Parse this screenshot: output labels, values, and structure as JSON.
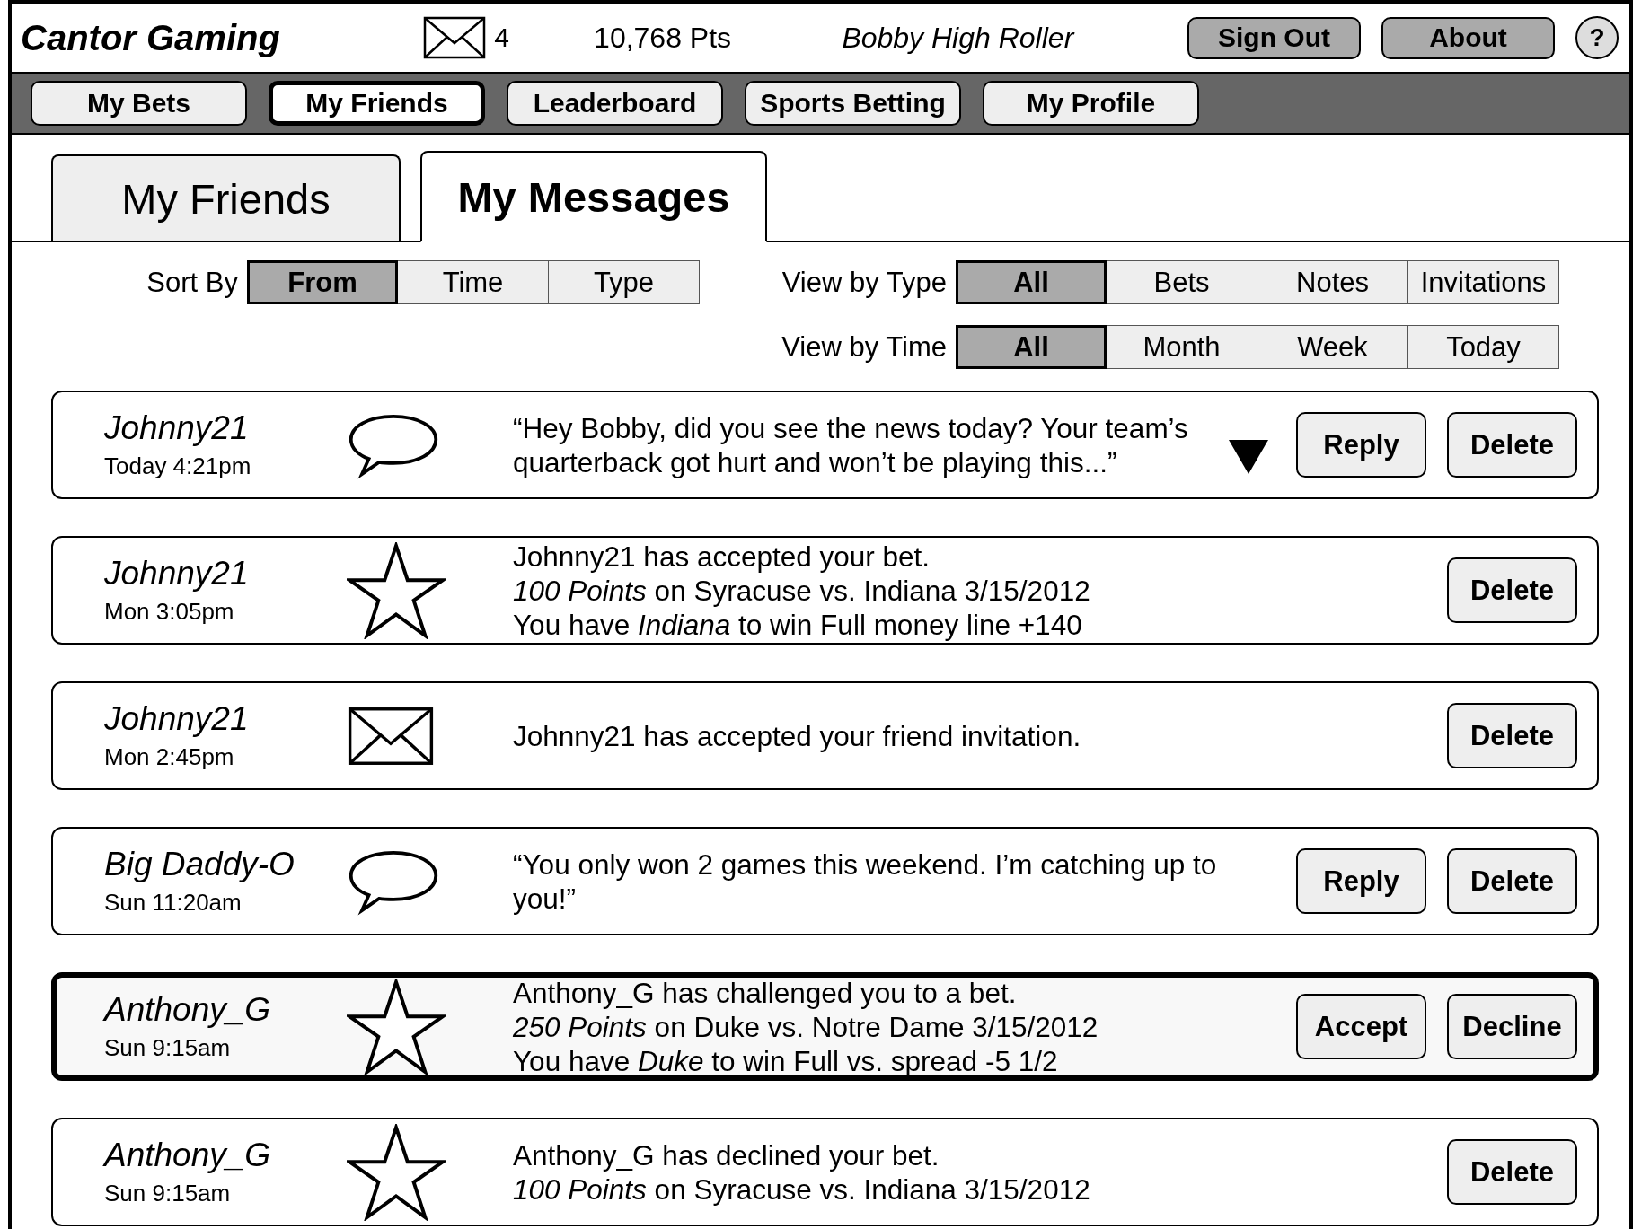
{
  "header": {
    "title": "Cantor Gaming",
    "mail_count": "4",
    "points": "10,768 Pts",
    "user": "Bobby High Roller",
    "buttons": [
      "Sign Out",
      "About"
    ],
    "help": "?"
  },
  "nav": [
    {
      "label": "My Bets",
      "selected": false
    },
    {
      "label": "My Friends",
      "selected": true
    },
    {
      "label": "Leaderboard",
      "selected": false
    },
    {
      "label": "Sports Betting",
      "selected": false
    },
    {
      "label": "My Profile",
      "selected": false
    }
  ],
  "tabs": [
    {
      "label": "My Friends",
      "selected": false
    },
    {
      "label": "My Messages",
      "selected": true
    }
  ],
  "filters": [
    {
      "label": "Sort By",
      "options": [
        {
          "label": "From",
          "selected": true
        },
        {
          "label": "Time",
          "selected": false
        },
        {
          "label": "Type",
          "selected": false
        }
      ]
    },
    {
      "label": "View by Type",
      "options": [
        {
          "label": "All",
          "selected": true
        },
        {
          "label": "Bets",
          "selected": false
        },
        {
          "label": "Notes",
          "selected": false
        },
        {
          "label": "Invitations",
          "selected": false
        }
      ]
    },
    {
      "label": "View by Time",
      "options": [
        {
          "label": "All",
          "selected": true
        },
        {
          "label": "Month",
          "selected": false
        },
        {
          "label": "Week",
          "selected": false
        },
        {
          "label": "Today",
          "selected": false
        }
      ]
    }
  ],
  "messages": [
    {
      "from": "Johnny21",
      "time": "Today 4:21pm",
      "kind": "note",
      "lines": [
        "“Hey Bobby, did you see the news today? Your team’s quarterback got hurt and won’t be playing this...”"
      ],
      "expandable": true,
      "highlighted": false,
      "actions": [
        "Reply",
        "Delete"
      ]
    },
    {
      "from": "Johnny21",
      "time": "Mon 3:05pm",
      "kind": "bet",
      "lines": [
        "Johnny21 has accepted your bet.",
        "*100 Points* on Syracuse vs. Indiana 3/15/2012",
        "You have *Indiana* to win Full money line +140"
      ],
      "expandable": false,
      "highlighted": false,
      "actions": [
        "Delete"
      ]
    },
    {
      "from": "Johnny21",
      "time": "Mon 2:45pm",
      "kind": "invitation",
      "lines": [
        "Johnny21 has accepted your friend invitation."
      ],
      "expandable": false,
      "highlighted": false,
      "actions": [
        "Delete"
      ]
    },
    {
      "from": "Big Daddy-O",
      "time": "Sun 11:20am",
      "kind": "note",
      "lines": [
        "“You only won 2 games this weekend. I’m catching up to you!”"
      ],
      "expandable": false,
      "highlighted": false,
      "actions": [
        "Reply",
        "Delete"
      ]
    },
    {
      "from": "Anthony_G",
      "time": "Sun 9:15am",
      "kind": "bet",
      "lines": [
        "Anthony_G has challenged you to a bet.",
        "*250 Points* on Duke vs. Notre Dame 3/15/2012",
        "You have *Duke* to win Full vs. spread -5 1/2"
      ],
      "expandable": false,
      "highlighted": true,
      "actions": [
        "Accept",
        "Decline"
      ]
    },
    {
      "from": "Anthony_G",
      "time": "Sun 9:15am",
      "kind": "bet",
      "lines": [
        "Anthony_G has declined your bet.",
        "*100 Points* on Syracuse vs. Indiana 3/15/2012"
      ],
      "expandable": false,
      "highlighted": false,
      "actions": [
        "Delete"
      ]
    }
  ]
}
